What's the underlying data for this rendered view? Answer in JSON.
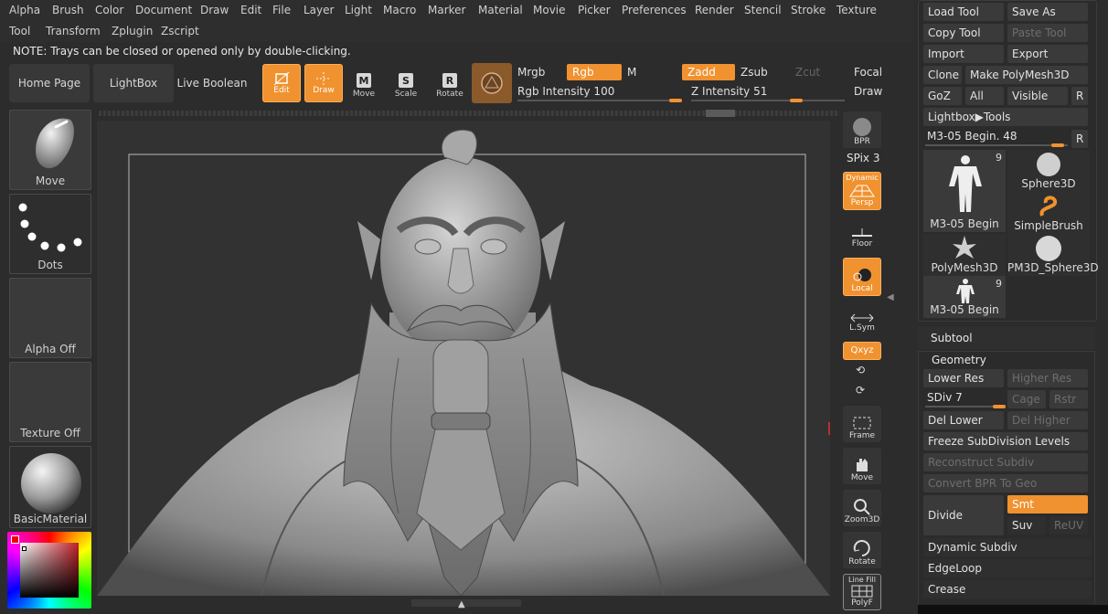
{
  "menu": [
    "Alpha",
    "Brush",
    "Color",
    "Document",
    "Draw",
    "Edit",
    "File",
    "Layer",
    "Light",
    "Macro",
    "Marker",
    "Material",
    "Movie",
    "Picker",
    "Preferences",
    "Render",
    "Stencil",
    "Stroke",
    "Texture",
    "Tool",
    "Transform",
    "Zplugin",
    "Zscript"
  ],
  "note": "NOTE: Trays can be closed or opened only by double-clicking.",
  "shelf": {
    "home": "Home Page",
    "lightbox": "LightBox",
    "live_boolean": "Live Boolean",
    "edit": "Edit",
    "draw": "Draw",
    "move": "Move",
    "scale": "Scale",
    "rotate": "Rotate",
    "move_key": "M",
    "scale_key": "S",
    "rotate_key": "R",
    "mrgb": "Mrgb",
    "rgb": "Rgb",
    "m": "M",
    "zadd": "Zadd",
    "zsub": "Zsub",
    "zcut": "Zcut",
    "focal": "Focal S",
    "draw_label": "Draw",
    "rgb_intensity": "Rgb Intensity 100",
    "z_intensity": "Z Intensity 51",
    "rgb_intensity_value": 100,
    "z_intensity_value": 51
  },
  "left_tray": {
    "move": "Move",
    "dots": "Dots",
    "alpha": "Alpha Off",
    "texture": "Texture Off",
    "material": "BasicMaterial"
  },
  "vtoolbar": {
    "bpr": "BPR",
    "spix": "SPix 3",
    "dynamic": "Dynamic",
    "persp": "Persp",
    "floor": "Floor",
    "local": "Local",
    "lsym": "L.Sym",
    "xyz": "Qxyz",
    "frame": "Frame",
    "move": "Move",
    "zoom": "Zoom3D",
    "rotate": "Rotate",
    "linefill": "Line Fill",
    "polyf": "PolyF"
  },
  "tool_panel": {
    "load": "Load Tool",
    "save_as": "Save As",
    "copy": "Copy Tool",
    "paste": "Paste Tool",
    "import": "Import",
    "export": "Export",
    "clone": "Clone",
    "make_polymesh": "Make PolyMesh3D",
    "goz": "GoZ",
    "all": "All",
    "visible": "Visible",
    "r": "R",
    "lightbox_tools": "Lightbox▶Tools",
    "current_tool": "M3-05 Begin. 48",
    "thumbs": [
      {
        "label": "M3-05 Begin",
        "count": "9"
      },
      {
        "label": "Sphere3D"
      },
      {
        "label": "SimpleBrush"
      },
      {
        "label": "PolyMesh3D"
      },
      {
        "label": "PM3D_Sphere3D"
      },
      {
        "label": "M3-05 Begin",
        "count": "9"
      }
    ]
  },
  "subtool": "Subtool",
  "geometry": {
    "title": "Geometry",
    "lower_res": "Lower Res",
    "higher_res": "Higher Res",
    "sdiv": "SDiv 7",
    "cage": "Cage",
    "rstr": "Rstr",
    "del_lower": "Del Lower",
    "del_higher": "Del Higher",
    "freeze": "Freeze SubDivision Levels",
    "reconstruct": "Reconstruct Subdiv",
    "convert_bpr": "Convert BPR To Geo",
    "divide": "Divide",
    "smt": "Smt",
    "suv": "Suv",
    "reuv": "ReUV",
    "dynamic_subdiv": "Dynamic Subdiv",
    "edgeloop": "EdgeLoop",
    "crease": "Crease"
  },
  "colors": {
    "accent": "#f0922f",
    "bg": "#2c2c2c"
  }
}
